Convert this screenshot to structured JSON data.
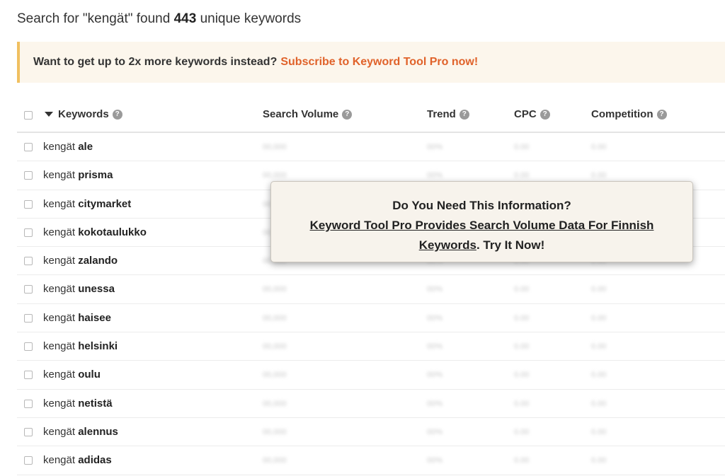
{
  "summary": {
    "prefix": "Search for \"kengät\" found",
    "count": "443",
    "suffix": "unique keywords"
  },
  "promo": {
    "text": "Want to get up to 2x more keywords instead?",
    "link": "Subscribe to Keyword Tool Pro now!"
  },
  "table": {
    "headers": {
      "keywords": "Keywords",
      "search_volume": "Search Volume",
      "trend": "Trend",
      "cpc": "CPC",
      "competition": "Competition"
    },
    "help_glyph": "?",
    "rows": [
      {
        "base": "kengät",
        "suffix": "ale"
      },
      {
        "base": "kengät",
        "suffix": "prisma"
      },
      {
        "base": "kengät",
        "suffix": "citymarket"
      },
      {
        "base": "kengät",
        "suffix": "kokotaulukko"
      },
      {
        "base": "kengät",
        "suffix": "zalando"
      },
      {
        "base": "kengät",
        "suffix": "unessa"
      },
      {
        "base": "kengät",
        "suffix": "haisee"
      },
      {
        "base": "kengät",
        "suffix": "helsinki"
      },
      {
        "base": "kengät",
        "suffix": "oulu"
      },
      {
        "base": "kengät",
        "suffix": "netistä"
      },
      {
        "base": "kengät",
        "suffix": "alennus"
      },
      {
        "base": "kengät",
        "suffix": "adidas"
      }
    ],
    "placeholders": {
      "volume": "00,000",
      "trend": "00%",
      "cpc": "0.00",
      "competition": "0.00"
    }
  },
  "modal": {
    "title": "Do You Need This Information?",
    "line1": "Keyword Tool Pro Provides Search Volume Data For Finnish",
    "line2_link": "Keywords",
    "line2_rest": ". Try It Now!"
  },
  "colors": {
    "accent": "#e0622a",
    "promo_bg": "#fcf6ec",
    "promo_border": "#f0c060",
    "modal_bg": "#f7f3ec"
  }
}
